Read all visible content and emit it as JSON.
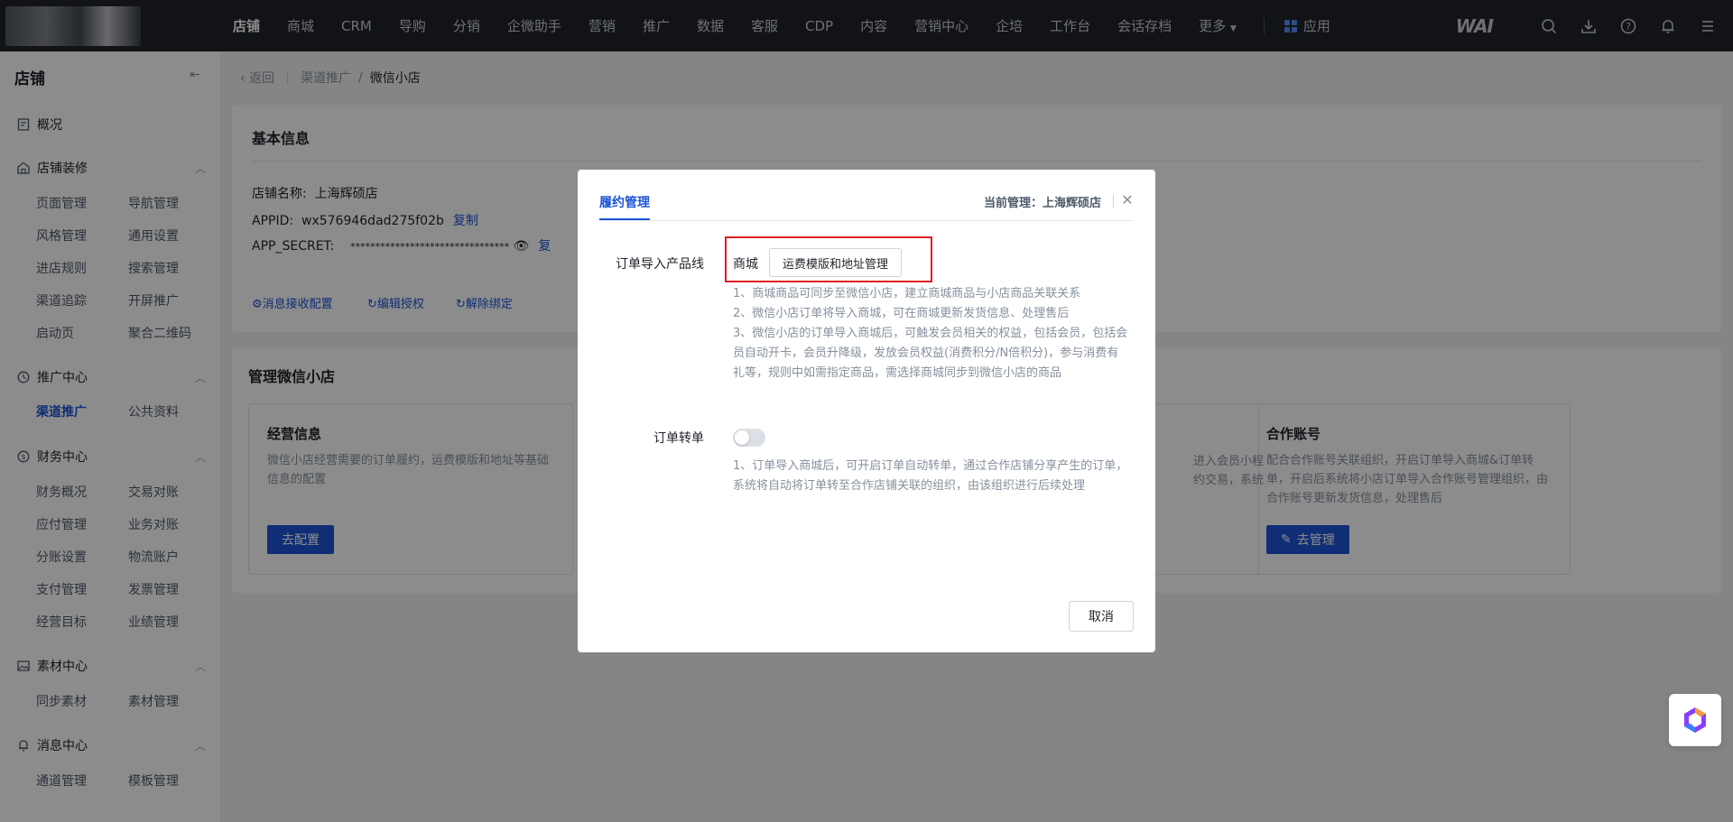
{
  "topnav": {
    "items": [
      "店铺",
      "商城",
      "CRM",
      "导购",
      "分销",
      "企微助手",
      "营销",
      "推广",
      "数据",
      "客服",
      "CDP",
      "内容",
      "营销中心",
      "企培",
      "工作台",
      "会话存档",
      "更多"
    ],
    "apps_label": "应用",
    "brand": "WAI"
  },
  "sidebar": {
    "title": "店铺",
    "overview": "概况",
    "sections": [
      {
        "label": "店铺装修",
        "links": [
          "页面管理",
          "导航管理",
          "风格管理",
          "通用设置",
          "进店规则",
          "搜索管理",
          "渠道追踪",
          "开屏推广",
          "启动页",
          "聚合二维码"
        ]
      },
      {
        "label": "推广中心",
        "links": [
          "渠道推广",
          "公共资料"
        ]
      },
      {
        "label": "财务中心",
        "links": [
          "财务概况",
          "交易对账",
          "应付管理",
          "业务对账",
          "分账设置",
          "物流账户",
          "支付管理",
          "发票管理",
          "经营目标",
          "业绩管理"
        ]
      },
      {
        "label": "素材中心",
        "links": [
          "同步素材",
          "素材管理"
        ]
      },
      {
        "label": "消息中心",
        "links": [
          "通道管理",
          "模板管理"
        ]
      }
    ]
  },
  "breadcrumb": {
    "back": "返回",
    "parent": "渠道推广",
    "sep": "/",
    "current": "微信小店"
  },
  "basic_info": {
    "title": "基本信息",
    "shop_name_label": "店铺名称:",
    "shop_name": "上海辉硕店",
    "appid_label": "APPID:",
    "appid": "wx576946dad275f02b",
    "copy": "复制",
    "secret_label": "APP_SECRET:",
    "secret": "********************************",
    "copy2": "复",
    "actions": [
      "消息接收配置",
      "编辑授权",
      "解除绑定"
    ]
  },
  "manage": {
    "title": "管理微信小店",
    "cards": [
      {
        "title": "经营信息",
        "desc": "微信小店经营需要的订单履约，运费模版和地址等基础信息的配置",
        "button": "去配置"
      },
      {
        "title": "合作账号",
        "desc": "配合合作账号关联组织，开启订单导入商城&订单转单，开启后系统将小店订单导入合作账号管理组织，由合作账号更新发货信息，处理售后",
        "button": "去管理"
      }
    ],
    "partial_text": [
      "进入会员小程",
      "约交易，系统"
    ]
  },
  "modal": {
    "tab": "履约管理",
    "current_label": "当前管理：上海辉硕店",
    "order_import_label": "订单导入产品线",
    "mall": "商城",
    "freight_button": "运费模版和地址管理",
    "notes1": [
      "1、商城商品可同步至微信小店，建立商城商品与小店商品关联关系",
      "2、微信小店订单将导入商城，可在商城更新发货信息、处理售后",
      "3、微信小店的订单导入商城后，可触发会员相关的权益，包括会员，包括会员自动开卡，会员升降级，发放会员权益(消费积分/N倍积分)，参与消费有礼等，规则中如需指定商品，需选择商城同步到微信小店的商品"
    ],
    "transfer_label": "订单转单",
    "transfer_on": false,
    "notes2": [
      "1、订单导入商城后，可开启订单自动转单，通过合作店铺分享产生的订单，系统将自动将订单转至合作店铺关联的组织，由该组织进行后续处理"
    ],
    "cancel": "取消"
  },
  "colors": {
    "primary": "#1e54d6",
    "nav_bg": "#1f2329",
    "highlight": "#e02020"
  }
}
